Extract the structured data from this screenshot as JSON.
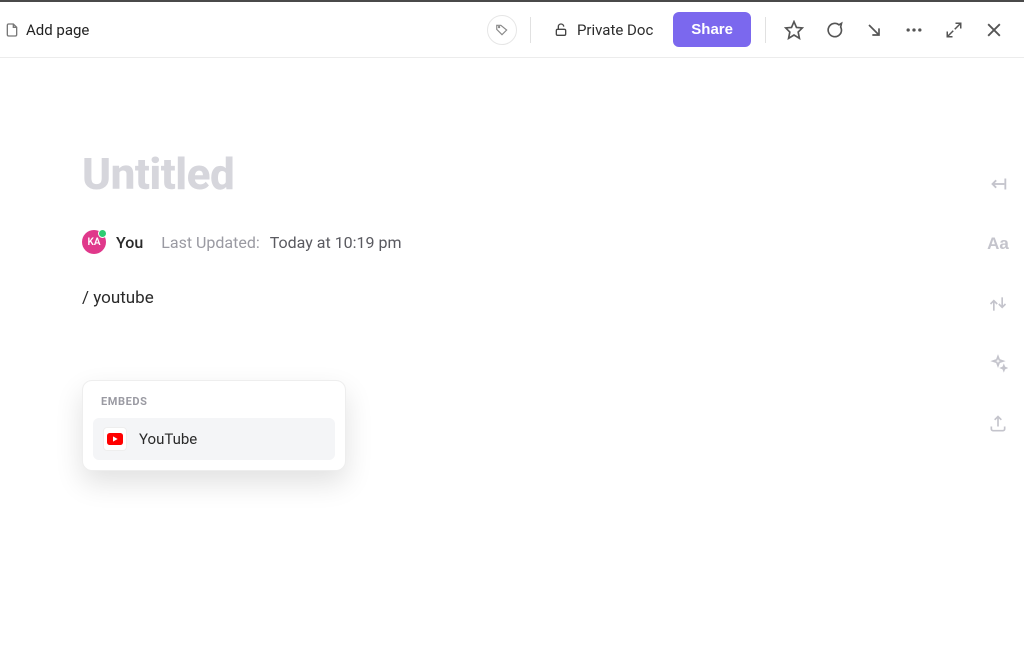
{
  "toolbar": {
    "add_page_label": "Add page",
    "privacy_label": "Private Doc",
    "share_label": "Share"
  },
  "doc": {
    "title_placeholder": "Untitled",
    "author_initials": "KA",
    "author_display": "You",
    "last_updated_label": "Last Updated:",
    "last_updated_value": "Today at 10:19 pm",
    "editor_input": "/ youtube"
  },
  "slash_menu": {
    "section_label": "EMBEDS",
    "items": [
      {
        "label": "YouTube",
        "icon": "youtube-icon"
      }
    ]
  },
  "right_rail": {
    "typography_label": "Aa"
  }
}
